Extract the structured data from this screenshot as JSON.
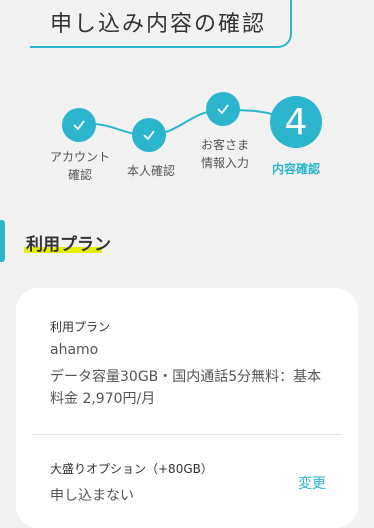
{
  "header": {
    "title": "申し込み内容の確認"
  },
  "stepper": {
    "steps": [
      {
        "label": "アカウント\n確認",
        "state": "done",
        "icon": "check-icon"
      },
      {
        "label": "本人確認",
        "state": "done",
        "icon": "check-icon"
      },
      {
        "label": "お客さま\n情報入力",
        "state": "done",
        "icon": "check-icon"
      },
      {
        "label": "内容確認",
        "state": "current",
        "number": "4"
      }
    ],
    "accent": "#2bb6cd"
  },
  "section": {
    "title": "利用プラン",
    "highlight": "#e5f000"
  },
  "plan": {
    "label": "利用プラン",
    "name": "ahamo",
    "description": "データ容量30GB・国内通話5分無料：基本料金 2,970円/月"
  },
  "option": {
    "label": "大盛りオプション（+80GB）",
    "value": "申し込まない",
    "change_label": "変更"
  }
}
